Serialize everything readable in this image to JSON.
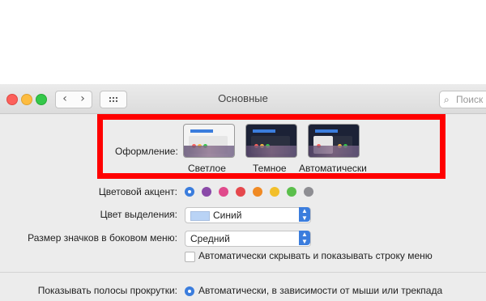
{
  "window": {
    "title": "Основные",
    "search_placeholder": "Поиск"
  },
  "appearance": {
    "label": "Оформление:",
    "options": [
      {
        "label": "Светлое",
        "selected": false
      },
      {
        "label": "Темное",
        "selected": false
      },
      {
        "label": "Автоматически",
        "selected": false
      }
    ]
  },
  "accent": {
    "label": "Цветовой акцент:",
    "colors": [
      "#3b7ddd",
      "#8a4aa8",
      "#e04a8c",
      "#e5484d",
      "#f08a24",
      "#f2bf2b",
      "#5bbf4c",
      "#8e8e93"
    ],
    "selected_index": 0
  },
  "highlight": {
    "label": "Цвет выделения:",
    "value": "Синий"
  },
  "sidebar_icon_size": {
    "label": "Размер значков в боковом меню:",
    "value": "Средний"
  },
  "auto_hide_menu": {
    "label": "Автоматически скрывать и показывать строку меню",
    "checked": false
  },
  "scrollbars": {
    "label": "Показывать полосы прокрутки:",
    "option": "Автоматически, в зависимости от мыши или трекпада"
  }
}
